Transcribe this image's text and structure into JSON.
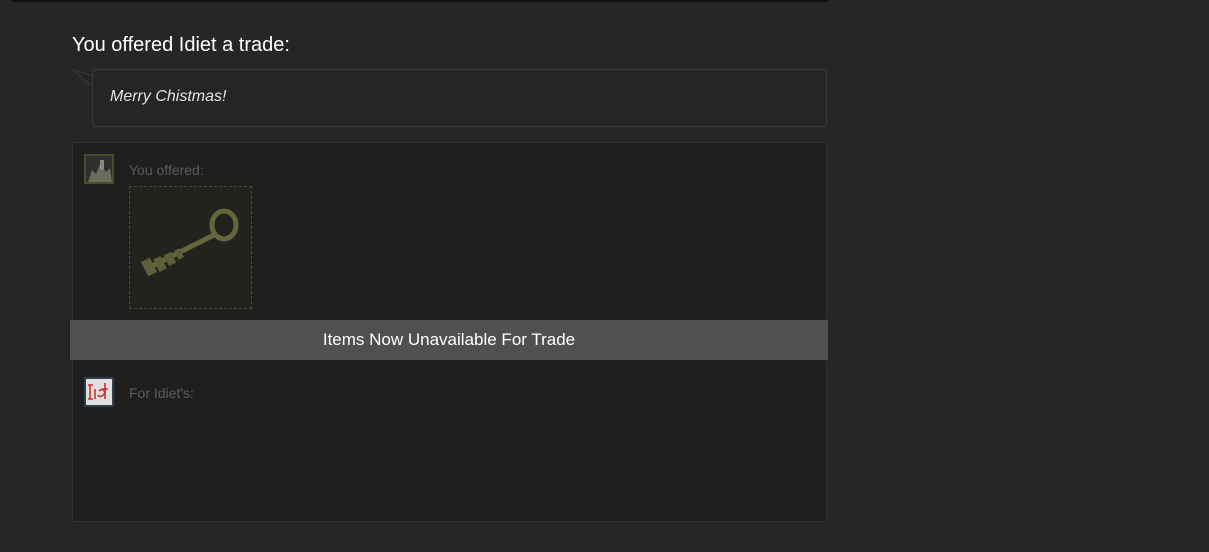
{
  "trade": {
    "heading": "You offered Idiet a trade:",
    "message": "Merry Chistmas!",
    "you_offered_label": "You offered:",
    "for_label": "For Idiet's:",
    "status_banner": "Items Now Unavailable For Trade",
    "offered_items": [
      {
        "icon": "key-icon"
      }
    ],
    "avatars": {
      "you": "user-avatar",
      "them": "idiet-avatar"
    }
  },
  "colors": {
    "background": "#262626",
    "panel": "#1f1f1f",
    "banner": "#505050",
    "item_border": "#4a4a2e",
    "key": "#6b6b3e"
  }
}
